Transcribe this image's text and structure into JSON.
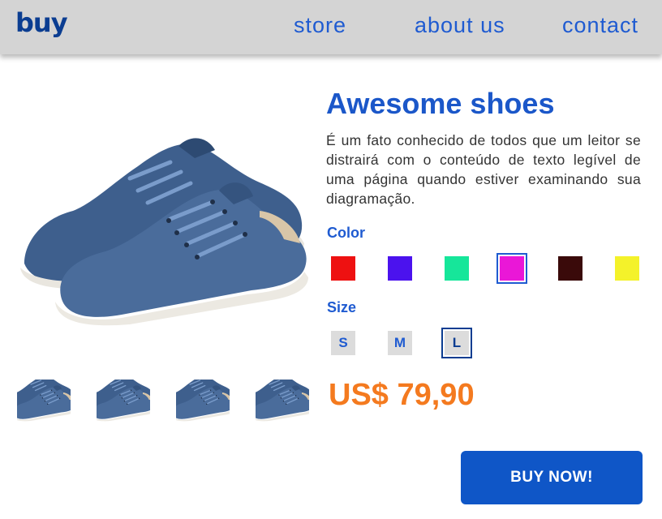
{
  "header": {
    "logo": "buy",
    "nav": [
      {
        "label": "store"
      },
      {
        "label": "about us"
      },
      {
        "label": "contact"
      }
    ]
  },
  "product": {
    "title": "Awesome shoes",
    "description": "É um fato conhecido de todos que um leitor se distrairá com o conteúdo de texto legível de uma página quando estiver examinando sua diagramação.",
    "image_icon": "blue-suede-sneakers",
    "thumbnail_count": 4
  },
  "color": {
    "label": "Color",
    "swatches": [
      "#ee1111",
      "#4b12ee",
      "#16e69a",
      "#ea17d7",
      "#3a0a0a",
      "#f4f22a"
    ],
    "selected_index": 3
  },
  "size": {
    "label": "Size",
    "options": [
      "S",
      "M",
      "L"
    ],
    "selected": "L"
  },
  "price": "US$ 79,90",
  "buy_button": "BUY NOW!",
  "colors": {
    "brand_blue": "#1f5bd1",
    "price_orange": "#f47a1f",
    "button_blue": "#0f56c7",
    "header_bg": "#d4d4d4"
  }
}
